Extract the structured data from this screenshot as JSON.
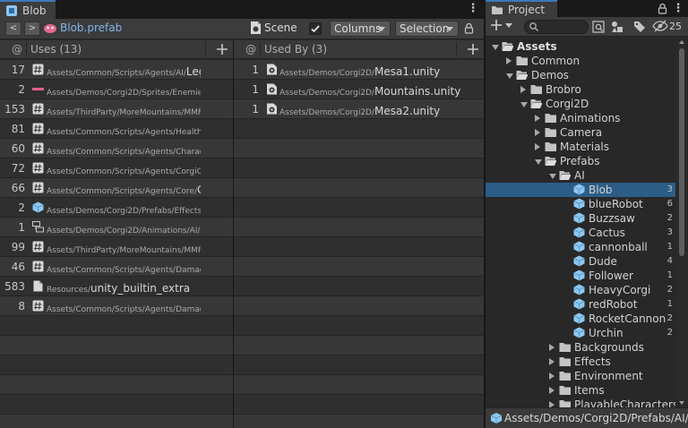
{
  "left_window": {
    "tab_title": "Blob",
    "nav_back": "<",
    "nav_forward": ">",
    "asset_name": "Blob.prefab",
    "scene_label": "Scene",
    "columns_label": "Columns",
    "selection_label": "Selection"
  },
  "uses_panel": {
    "at": "@",
    "title": "Uses (13)",
    "rows": [
      {
        "count": "17",
        "icon": "script-icon",
        "path": "Assets/Common/Scripts/Agents/AI/",
        "name": "Legac"
      },
      {
        "count": "2",
        "icon": "sprite-icon",
        "path": "Assets/Demos/Corgi2D/Sprites/Enemies/",
        "name": "B"
      },
      {
        "count": "153",
        "icon": "script-icon",
        "path": "Assets/ThirdParty/MoreMountains/MMFe",
        "name": ""
      },
      {
        "count": "81",
        "icon": "script-icon",
        "path": "Assets/Common/Scripts/Agents/Health/",
        "name": "H"
      },
      {
        "count": "60",
        "icon": "script-icon",
        "path": "Assets/Common/Scripts/Agents/Characte",
        "name": ""
      },
      {
        "count": "72",
        "icon": "script-icon",
        "path": "Assets/Common/Scripts/Agents/CorgiCo",
        "name": ""
      },
      {
        "count": "66",
        "icon": "script-icon",
        "path": "Assets/Common/Scripts/Agents/Core/",
        "name": "Ch"
      },
      {
        "count": "2",
        "icon": "prefab-icon",
        "path": "Assets/Demos/Corgi2D/Prefabs/Effects/",
        "name": "E"
      },
      {
        "count": "1",
        "icon": "animation-icon",
        "path": "Assets/Demos/Corgi2D/Animations/AI/",
        "name": "blo"
      },
      {
        "count": "99",
        "icon": "script-icon",
        "path": "Assets/ThirdParty/MoreMountains/MMFe",
        "name": ""
      },
      {
        "count": "46",
        "icon": "script-icon",
        "path": "Assets/Common/Scripts/Agents/Damage",
        "name": ""
      },
      {
        "count": "583",
        "icon": "file-icon",
        "path": "Resources/",
        "name": "unity_builtin_extra"
      },
      {
        "count": "8",
        "icon": "script-icon",
        "path": "Assets/Common/Scripts/Agents/Damage",
        "name": ""
      }
    ]
  },
  "used_by_panel": {
    "at": "@",
    "title": "Used By (3)",
    "rows": [
      {
        "count": "1",
        "icon": "scene-icon",
        "path": "Assets/Demos/Corgi2D/",
        "name": "Mesa1.unity"
      },
      {
        "count": "1",
        "icon": "scene-icon",
        "path": "Assets/Demos/Corgi2D/",
        "name": "Mountains.unity"
      },
      {
        "count": "1",
        "icon": "scene-icon",
        "path": "Assets/Demos/Corgi2D/",
        "name": "Mesa2.unity"
      }
    ]
  },
  "project_window": {
    "tab_title": "Project",
    "hidden_count": "25",
    "footer_path": "Assets/Demos/Corgi2D/Prefabs/AI/B",
    "tree": [
      {
        "label": "Assets",
        "depth": 0,
        "arrow": "open",
        "icon": "folder-open-icon",
        "bold": true
      },
      {
        "label": "Common",
        "depth": 1,
        "arrow": "closed",
        "icon": "folder-icon"
      },
      {
        "label": "Demos",
        "depth": 1,
        "arrow": "open",
        "icon": "folder-open-icon"
      },
      {
        "label": "Brobro",
        "depth": 2,
        "arrow": "closed",
        "icon": "folder-icon"
      },
      {
        "label": "Corgi2D",
        "depth": 2,
        "arrow": "open",
        "icon": "folder-open-icon"
      },
      {
        "label": "Animations",
        "depth": 3,
        "arrow": "closed",
        "icon": "folder-icon"
      },
      {
        "label": "Camera",
        "depth": 3,
        "arrow": "closed",
        "icon": "folder-icon"
      },
      {
        "label": "Materials",
        "depth": 3,
        "arrow": "closed",
        "icon": "folder-icon"
      },
      {
        "label": "Prefabs",
        "depth": 3,
        "arrow": "open",
        "icon": "folder-open-icon"
      },
      {
        "label": "AI",
        "depth": 4,
        "arrow": "open",
        "icon": "folder-open-icon"
      },
      {
        "label": "Blob",
        "depth": 5,
        "arrow": "none",
        "icon": "prefab-icon",
        "count": "3",
        "selected": true
      },
      {
        "label": "blueRobot",
        "depth": 5,
        "arrow": "none",
        "icon": "prefab-icon",
        "count": "6"
      },
      {
        "label": "Buzzsaw",
        "depth": 5,
        "arrow": "none",
        "icon": "prefab-icon",
        "count": "2"
      },
      {
        "label": "Cactus",
        "depth": 5,
        "arrow": "none",
        "icon": "prefab-icon",
        "count": "3"
      },
      {
        "label": "cannonball",
        "depth": 5,
        "arrow": "none",
        "icon": "prefab-icon",
        "count": "1"
      },
      {
        "label": "Dude",
        "depth": 5,
        "arrow": "none",
        "icon": "prefab-icon",
        "count": "4"
      },
      {
        "label": "Follower",
        "depth": 5,
        "arrow": "none",
        "icon": "prefab-icon",
        "count": "1"
      },
      {
        "label": "HeavyCorgi",
        "depth": 5,
        "arrow": "none",
        "icon": "prefab-icon",
        "count": "2"
      },
      {
        "label": "redRobot",
        "depth": 5,
        "arrow": "none",
        "icon": "prefab-icon",
        "count": "1"
      },
      {
        "label": "RocketCannon",
        "depth": 5,
        "arrow": "none",
        "icon": "prefab-icon",
        "count": "2"
      },
      {
        "label": "Urchin",
        "depth": 5,
        "arrow": "none",
        "icon": "prefab-icon",
        "count": "2"
      },
      {
        "label": "Backgrounds",
        "depth": 4,
        "arrow": "closed",
        "icon": "folder-icon"
      },
      {
        "label": "Effects",
        "depth": 4,
        "arrow": "closed",
        "icon": "folder-icon"
      },
      {
        "label": "Environment",
        "depth": 4,
        "arrow": "closed",
        "icon": "folder-icon"
      },
      {
        "label": "Items",
        "depth": 4,
        "arrow": "closed",
        "icon": "folder-icon"
      },
      {
        "label": "PlayableCharacters",
        "depth": 4,
        "arrow": "closed",
        "icon": "folder-icon"
      }
    ]
  },
  "colors": {
    "selection": "#2c5d87",
    "tab_accent": "#3a79bb",
    "prefab_blue": "#8ec7ef"
  }
}
